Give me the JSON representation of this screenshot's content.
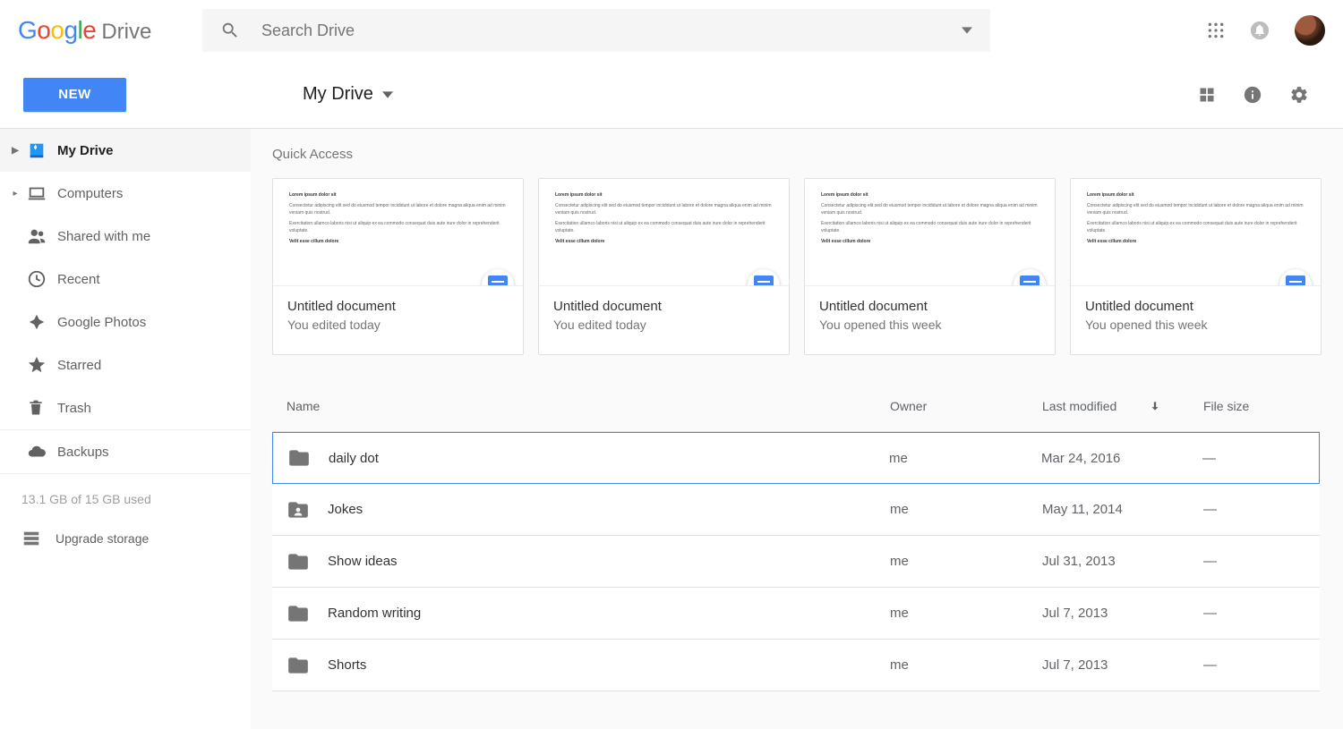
{
  "header": {
    "product_suffix": "Drive",
    "search_placeholder": "Search Drive"
  },
  "toolbar": {
    "new_button": "NEW",
    "path_label": "My Drive"
  },
  "sidebar": {
    "items": [
      {
        "label": "My Drive"
      },
      {
        "label": "Computers"
      },
      {
        "label": "Shared with me"
      },
      {
        "label": "Recent"
      },
      {
        "label": "Google Photos"
      },
      {
        "label": "Starred"
      },
      {
        "label": "Trash"
      },
      {
        "label": "Backups"
      }
    ],
    "storage_text": "13.1 GB of 15 GB used",
    "upgrade_label": "Upgrade storage"
  },
  "quick_access": {
    "title": "Quick Access",
    "cards": [
      {
        "title": "Untitled document",
        "subtitle": "You edited today"
      },
      {
        "title": "Untitled document",
        "subtitle": "You edited today"
      },
      {
        "title": "Untitled document",
        "subtitle": "You opened this week"
      },
      {
        "title": "Untitled document",
        "subtitle": "You opened this week"
      }
    ]
  },
  "table": {
    "columns": {
      "name": "Name",
      "owner": "Owner",
      "modified": "Last modified",
      "size": "File size"
    },
    "rows": [
      {
        "name": "daily dot",
        "owner": "me",
        "modified": "Mar 24, 2016",
        "size": "—",
        "shared": false,
        "selected": true
      },
      {
        "name": "Jokes",
        "owner": "me",
        "modified": "May 11, 2014",
        "size": "—",
        "shared": true,
        "selected": false
      },
      {
        "name": "Show ideas",
        "owner": "me",
        "modified": "Jul 31, 2013",
        "size": "—",
        "shared": false,
        "selected": false
      },
      {
        "name": "Random writing",
        "owner": "me",
        "modified": "Jul 7, 2013",
        "size": "—",
        "shared": false,
        "selected": false
      },
      {
        "name": "Shorts",
        "owner": "me",
        "modified": "Jul 7, 2013",
        "size": "—",
        "shared": false,
        "selected": false
      }
    ]
  }
}
